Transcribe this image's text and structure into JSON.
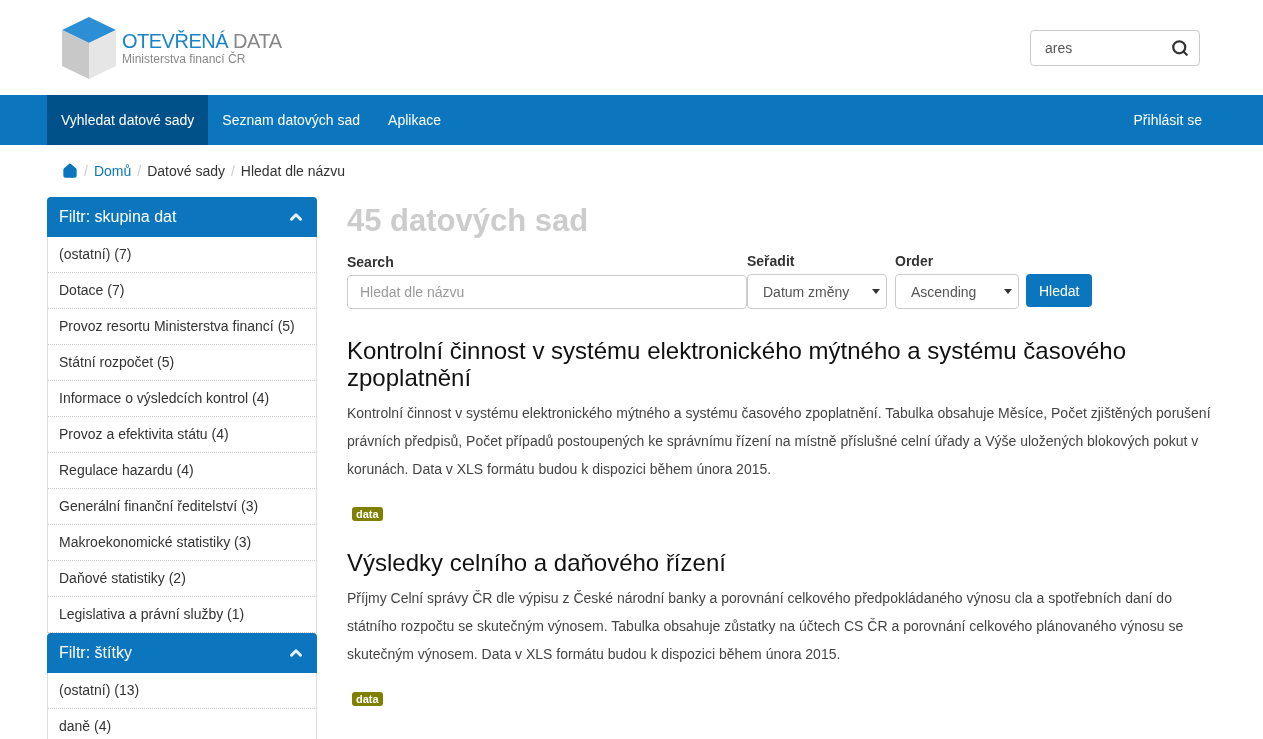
{
  "header": {
    "logo": {
      "title_main": "OTEVŘENÁ",
      "title_rest": "DATA",
      "subtitle": "Ministerstva financí ČR"
    },
    "search": {
      "value": "ares"
    }
  },
  "nav": {
    "items": [
      {
        "label": "Vyhledat datové sady",
        "selected": true
      },
      {
        "label": "Seznam datových sad",
        "selected": false
      },
      {
        "label": "Aplikace",
        "selected": false
      }
    ],
    "login": "Přihlásit se"
  },
  "breadcrumb_separator": "/",
  "breadcrumb": [
    {
      "kind": "home"
    },
    {
      "kind": "link",
      "label": "Domů"
    },
    {
      "kind": "text",
      "label": "Datové sady"
    },
    {
      "kind": "text",
      "label": "Hledat dle názvu"
    }
  ],
  "filters": [
    {
      "title": "Filtr: skupina dat",
      "expanded": true,
      "items": [
        "(ostatní) (7)",
        "Dotace (7)",
        "Provoz resortu Ministerstva financí (5)",
        "Státní rozpočet (5)",
        "Informace o výsledcích kontrol (4)",
        "Provoz a efektivita státu (4)",
        "Regulace hazardu (4)",
        "Generální finanční ředitelství (3)",
        "Makroekonomické statistiky (3)",
        "Daňové statistiky (2)",
        "Legislativa a právní služby (1)"
      ]
    },
    {
      "title": "Filtr: štítky",
      "expanded": true,
      "items": [
        "(ostatní) (13)",
        "daně (4)"
      ]
    }
  ],
  "results": {
    "count_title": "45 datových sad",
    "search_label": "Search",
    "search_placeholder": "Hledat dle názvu",
    "sort_label": "Seřadit",
    "sort_value": "Datum změny",
    "order_label": "Order",
    "order_value": "Ascending",
    "button": "Hledat"
  },
  "datasets": [
    {
      "title": "Kontrolní činnost v systému elektronického mýtného a systému časového zpoplatnění",
      "description": "Kontrolní činnost v systému elektronického mýtného a systému časového zpoplatnění. Tabulka obsahuje Měsíce, Počet zjištěných porušení právních předpisů, Počet případů postoupených ke správnímu řízení na místně příslušné celní úřady a Výše uložených blokových pokut v korunách. Data v XLS formátu budou k dispozici během února 2015.",
      "tags": [
        "data"
      ]
    },
    {
      "title": "Výsledky celního a daňového řízení",
      "description": "Příjmy Celní správy ČR dle výpisu z České národní banky a porovnání celkového předpokládaného výnosu cla a spotřebních daní do státního rozpočtu se skutečným výnosem. Tabulka obsahuje zůstatky na účtech CS ČR a porovnání celkového plánovaného výnosu se skutečným výnosem. Data v XLS formátu budou k dispozici během února 2015.",
      "tags": [
        "data"
      ]
    }
  ]
}
